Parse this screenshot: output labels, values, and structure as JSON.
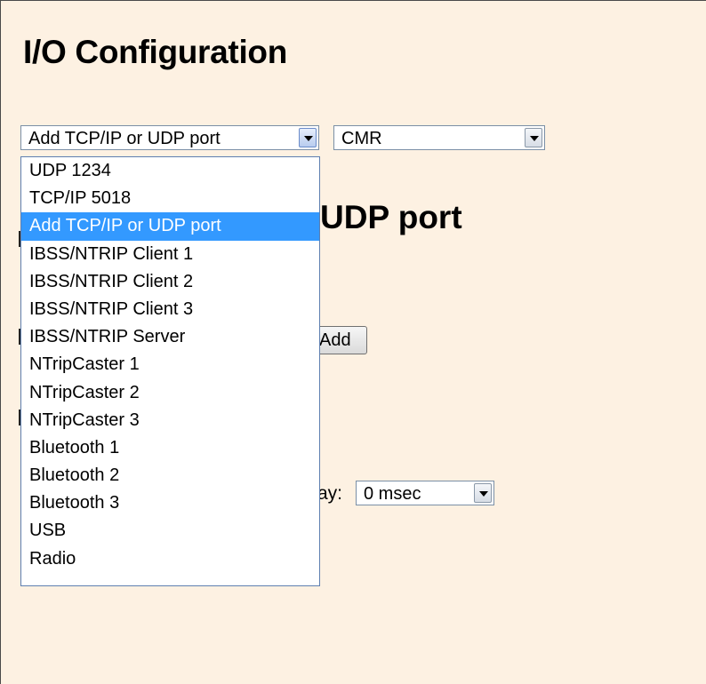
{
  "page": {
    "title": "I/O Configuration"
  },
  "port_select": {
    "selected": "Add TCP/IP or UDP port",
    "options": [
      "UDP 1234",
      "TCP/IP 5018",
      "Add TCP/IP or UDP port",
      "IBSS/NTRIP Client 1",
      "IBSS/NTRIP Client 2",
      "IBSS/NTRIP Client 3",
      "IBSS/NTRIP Server",
      "NTripCaster 1",
      "NTripCaster 2",
      "NTripCaster 3",
      "Bluetooth 1",
      "Bluetooth 2",
      "Bluetooth 3",
      "USB",
      "Radio"
    ],
    "highlighted_index": 2
  },
  "format_select": {
    "selected": "CMR"
  },
  "section": {
    "heading_visible": "UDP port"
  },
  "add_button": {
    "label": "Add"
  },
  "delay": {
    "label_visible": "ay:",
    "selected": "0 msec"
  },
  "colors": {
    "page_bg": "#fdf1e2",
    "highlight": "#3399ff"
  }
}
